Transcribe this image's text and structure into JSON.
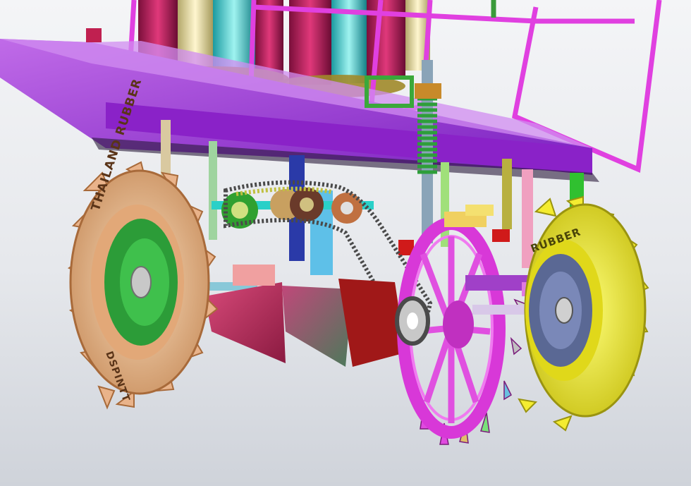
{
  "scene": {
    "kind": "3D CAD render",
    "subject": "wheeled planting machine undercarriage with chain drive"
  },
  "tire_imprint": {
    "brand_line": "THAILAND RUBBER",
    "maker_line": "DSPINTT",
    "right_line": "RUBBER"
  },
  "colors": {
    "background": "#e6e8ec",
    "frame": "#d836d8",
    "deck": "#9a2fd6",
    "left_tire": "#f0c49a",
    "left_rim": "#2fae3a",
    "right_tire": "#f2f01a",
    "right_rim": "#6a78a8",
    "spike_wheel": "#d43ad4",
    "chain": "#5a5a5a",
    "spring": "#3fb84a"
  }
}
